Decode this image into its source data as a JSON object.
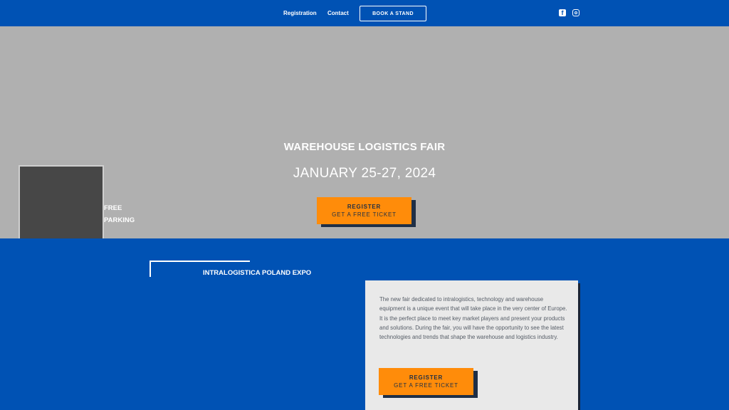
{
  "nav": {
    "links": [
      "Registration",
      "Contact"
    ],
    "book_button": "BOOK A STAND",
    "social": [
      {
        "icon": "facebook-icon",
        "glyph": "f"
      },
      {
        "icon": "instagram-icon"
      }
    ]
  },
  "hero": {
    "title": "WAREHOUSE LOGISTICS FAIR",
    "date": "JANUARY 25-27, 2024",
    "cta": {
      "line1": "REGISTER",
      "line2": "GET A FREE TICKET"
    },
    "parking": {
      "line1": "FREE",
      "line2": "PARKING"
    }
  },
  "section": {
    "title": "INTRALOGISTICA POLAND EXPO",
    "description": "The new fair dedicated to intralogistics, technology and warehouse equipment is a unique event that will take place in the very center of Europe. It is the perfect place to meet key market players and present your products and solutions. During the fair, you will have the opportunity to see the latest technologies and trends that shape the warehouse and logistics industry.",
    "cta": {
      "line1": "REGISTER",
      "line2": "GET A FREE TICKET"
    }
  },
  "colors": {
    "brand_blue": "#0052b4",
    "accent_orange": "#ff8c0a",
    "hero_gray": "#b0b0b0",
    "card_bg": "#e9e9e9"
  }
}
